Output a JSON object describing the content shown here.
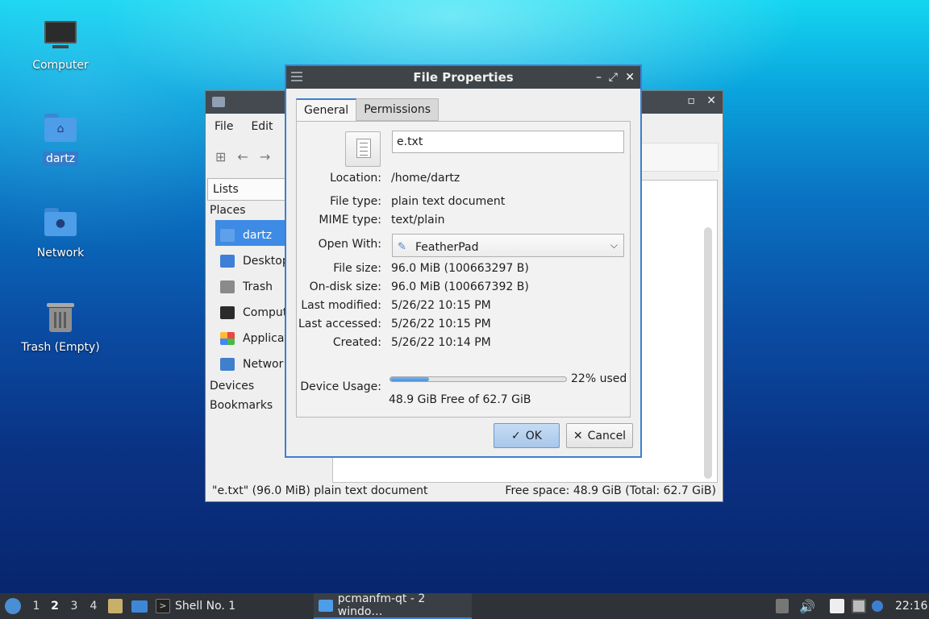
{
  "desktop": {
    "icons": [
      {
        "label": "Computer",
        "icon": "computer-icon"
      },
      {
        "label": "dartz",
        "icon": "home-folder-icon"
      },
      {
        "label": "Network",
        "icon": "network-folder-icon"
      },
      {
        "label": "Trash (Empty)",
        "icon": "trash-icon"
      }
    ]
  },
  "file_manager": {
    "menu": [
      "File",
      "Edit"
    ],
    "lists_label": "Lists",
    "places_header": "Places",
    "places": [
      "dartz",
      "Desktop",
      "Trash",
      "Comput",
      "Applicat",
      "Networ"
    ],
    "devices_header": "Devices",
    "bookmarks_header": "Bookmarks",
    "status_left": "\"e.txt\" (96.0 MiB) plain text document",
    "status_right": "Free space: 48.9 GiB (Total: 62.7 GiB)"
  },
  "dialog": {
    "title": "File Properties",
    "tabs": [
      "General",
      "Permissions"
    ],
    "file_name": "e.txt",
    "location_label": "Location:",
    "location": "/home/dartz",
    "file_type_label": "File type:",
    "file_type": "plain text document",
    "mime_label": "MIME type:",
    "mime": "text/plain",
    "open_with_label": "Open With:",
    "open_with": "FeatherPad",
    "file_size_label": "File size:",
    "file_size": "96.0 MiB (100663297 B)",
    "disk_size_label": "On-disk size:",
    "disk_size": "96.0 MiB (100667392 B)",
    "modified_label": "Last modified:",
    "modified": "5/26/22 10:15 PM",
    "accessed_label": "Last accessed:",
    "accessed": "5/26/22 10:15 PM",
    "created_label": "Created:",
    "created": "5/26/22 10:14 PM",
    "usage_label": "Device Usage:",
    "usage_fraction": 0.22,
    "usage_text": "22% used",
    "free_text": "48.9 GiB Free of 62.7 GiB",
    "ok_label": "OK",
    "cancel_label": "Cancel"
  },
  "taskbar": {
    "workspaces": [
      "1",
      "2",
      "3",
      "4"
    ],
    "current_workspace": "2",
    "tasks": [
      {
        "label": "Shell No. 1",
        "icon": "terminal-icon"
      },
      {
        "label": "pcmanfm-qt - 2 windo…",
        "icon": "folder-icon"
      }
    ],
    "clock": "22:16"
  },
  "colors": {
    "accent": "#3d7fcf",
    "titlebar": "#3f4448",
    "taskbar": "#2f3338"
  }
}
